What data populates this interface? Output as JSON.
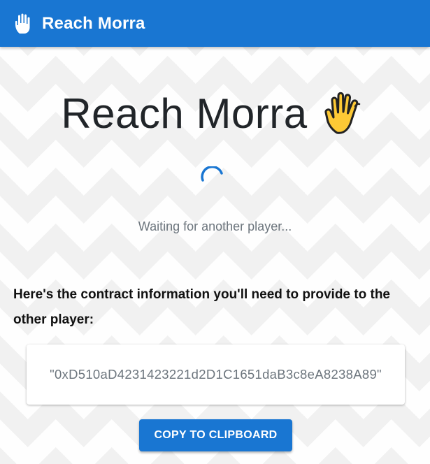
{
  "appbar": {
    "icon": "raised-hand-icon",
    "title": "Reach Morra"
  },
  "main": {
    "title": "Reach Morra",
    "title_icon": "raised-hand-with-fingers-splayed-icon",
    "status_icon": "loading-spinner-icon",
    "status": "Waiting for another player...",
    "info_heading": "Here's the contract information you'll need to provide to the other player:",
    "contract_info": "\"0xD510aD4231423221d2D1C1651daB3c8eA8238A89\"",
    "copy_button": "COPY TO CLIPBOARD"
  },
  "colors": {
    "primary": "#1976d2",
    "muted_text": "#6c757d",
    "title_text": "#212529",
    "emoji_yellow": "#fdc935"
  }
}
